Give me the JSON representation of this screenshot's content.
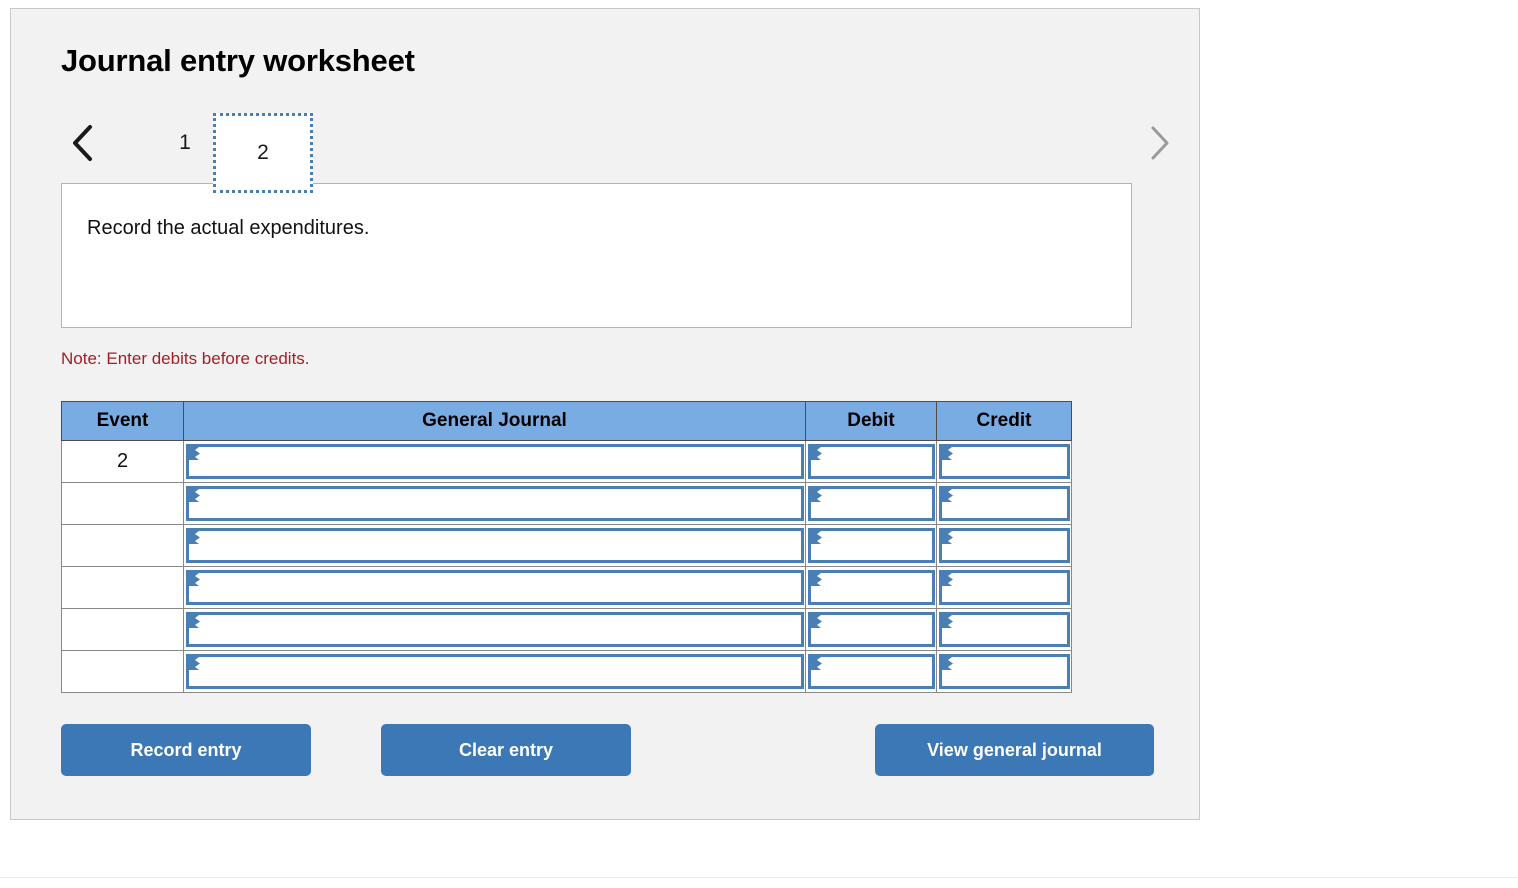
{
  "worksheet": {
    "title": "Journal entry worksheet",
    "prompt": "Record the actual expenditures.",
    "note": "Note: Enter debits before credits."
  },
  "pager": {
    "prev_icon": "chevron-left-icon",
    "next_icon": "chevron-right-icon",
    "tabs": [
      {
        "label": "1",
        "selected": false
      },
      {
        "label": "2",
        "selected": true
      }
    ],
    "selected_tab": "2",
    "prev_enabled_color": "#1a1a1a",
    "next_enabled_color": "#9a9a9a"
  },
  "table": {
    "headers": {
      "event": "Event",
      "general_journal": "General Journal",
      "debit": "Debit",
      "credit": "Credit"
    },
    "header_bg": "#7aacE4",
    "rows": [
      {
        "event": "2",
        "general_journal": "",
        "debit": "",
        "credit": ""
      },
      {
        "event": "",
        "general_journal": "",
        "debit": "",
        "credit": ""
      },
      {
        "event": "",
        "general_journal": "",
        "debit": "",
        "credit": ""
      },
      {
        "event": "",
        "general_journal": "",
        "debit": "",
        "credit": ""
      },
      {
        "event": "",
        "general_journal": "",
        "debit": "",
        "credit": ""
      },
      {
        "event": "",
        "general_journal": "",
        "debit": "",
        "credit": ""
      }
    ]
  },
  "buttons": {
    "record_entry": "Record entry",
    "clear_entry": "Clear entry",
    "view_general_journal": "View general journal",
    "bg_color": "#3b78b5"
  },
  "colors": {
    "panel_bg": "#f2f2f2",
    "note_red": "#a32025",
    "field_border_blue": "#4a7fb5",
    "tab_dotted_blue": "#4a7fb5"
  }
}
